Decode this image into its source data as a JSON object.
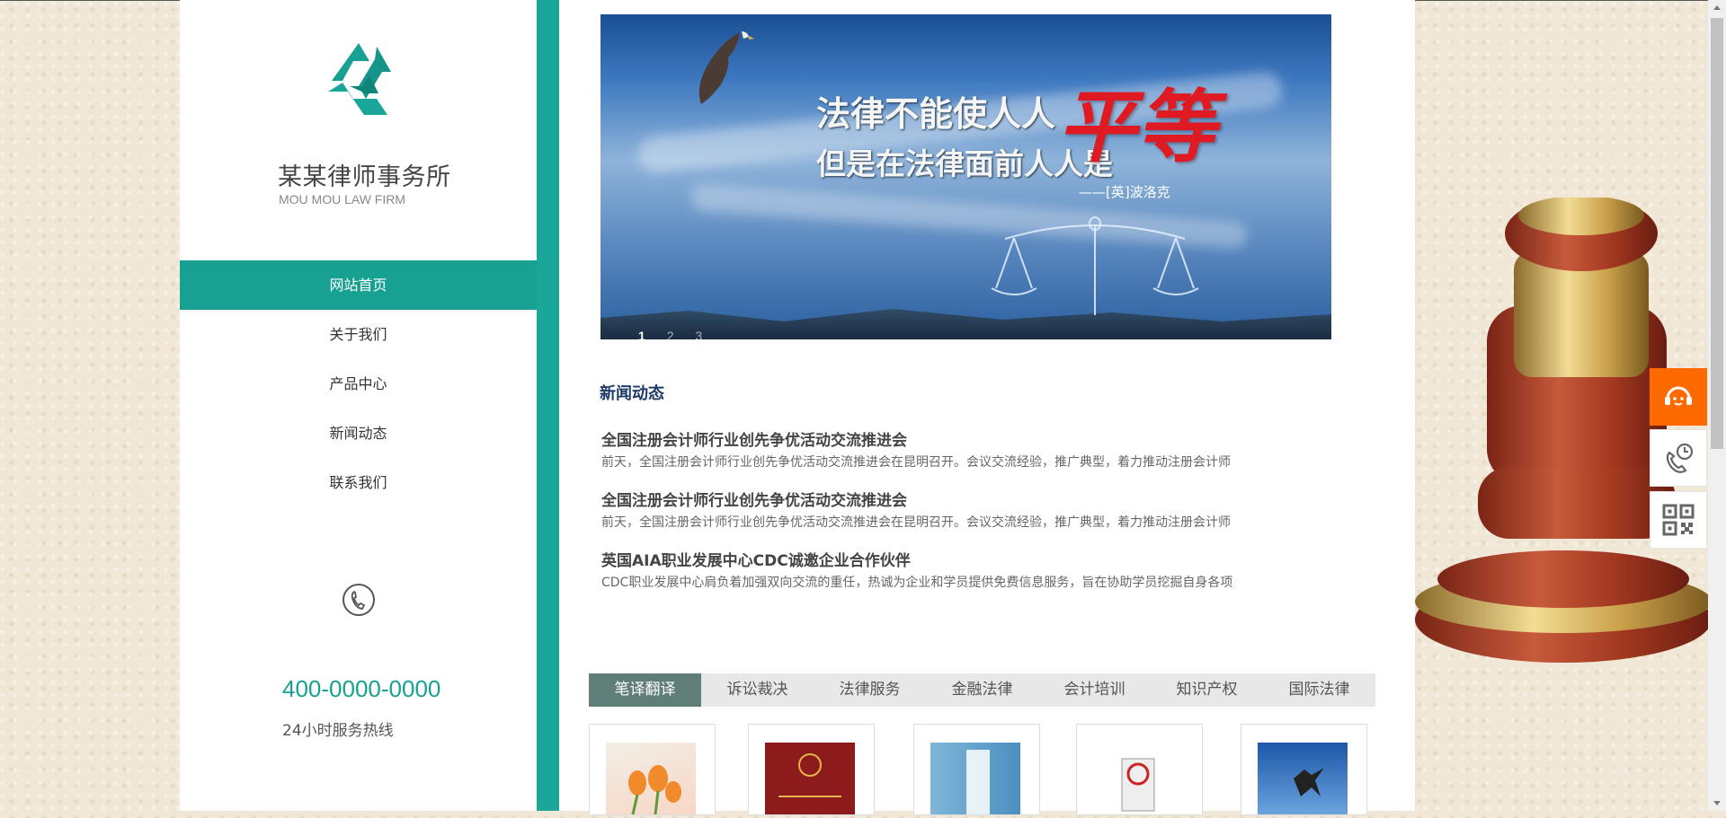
{
  "sidebar": {
    "brand_name": "某某律师事务所",
    "brand_en": "MOU MOU LAW FIRM",
    "nav": [
      {
        "label": "网站首页",
        "active": true
      },
      {
        "label": "关于我们"
      },
      {
        "label": "产品中心"
      },
      {
        "label": "新闻动态"
      },
      {
        "label": "联系我们"
      }
    ],
    "hotline": "400-0000-0000",
    "hotline_sub": "24小时服务热线",
    "phone_icon": "phone-icon"
  },
  "banner": {
    "line1": "法律不能使人人",
    "line2": "但是在法律面前人人是",
    "big_text": "平等",
    "author": "——[英]波洛克",
    "dots": [
      "1",
      "2",
      "3"
    ],
    "active_dot": 0
  },
  "news": {
    "title": "新闻动态",
    "items": [
      {
        "title": "全国注册会计师行业创先争优活动交流推进会",
        "desc": "前天，全国注册会计师行业创先争优活动交流推进会在昆明召开。会议交流经验，推广典型，着力推动注册会计师"
      },
      {
        "title": "全国注册会计师行业创先争优活动交流推进会",
        "desc": "前天，全国注册会计师行业创先争优活动交流推进会在昆明召开。会议交流经验，推广典型，着力推动注册会计师"
      },
      {
        "title": "英国AIA职业发展中心CDC诚邀企业合作伙伴",
        "desc": "CDC职业发展中心肩负着加强双向交流的重任，热诚为企业和学员提供免费信息服务，旨在协助学员挖掘自身各项"
      }
    ]
  },
  "tabs": [
    "笔译翻译",
    "诉讼裁决",
    "法律服务",
    "金融法律",
    "会计培训",
    "知识产权",
    "国际法律"
  ],
  "active_tab": 0,
  "colors": {
    "teal": "#17a192",
    "tab_active": "#607e79",
    "orange": "#ff6a00",
    "news_title": "#1e3b66"
  },
  "side_tools": [
    "customer-service-icon",
    "phone-clock-icon",
    "qr-code-icon"
  ]
}
